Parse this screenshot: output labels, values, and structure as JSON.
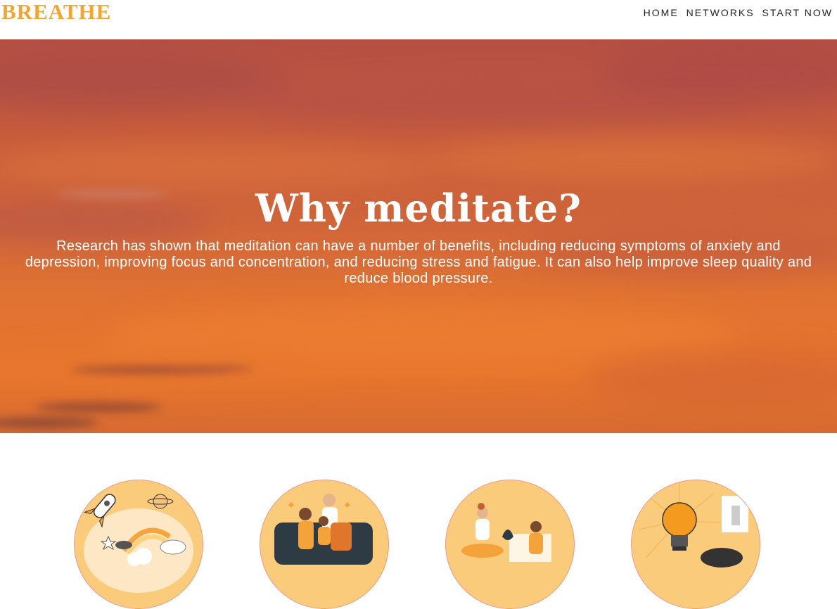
{
  "header": {
    "logo": "BREATHE",
    "nav": [
      {
        "label": "HOME"
      },
      {
        "label": "NETWORKS"
      },
      {
        "label": "START NOW"
      }
    ]
  },
  "hero": {
    "title": "Why meditate?",
    "text": "Research has shown that meditation can have a number of benefits, including reducing symptoms of anxiety and depression, improving focus and concentration, and reducing stress and fatigue. It can also help improve sleep quality and reduce blood pressure."
  },
  "features": [
    {
      "illustration": "rocket-rainbow-unicorn-illustration"
    },
    {
      "illustration": "family-on-couch-illustration"
    },
    {
      "illustration": "people-meditating-illustration"
    },
    {
      "illustration": "lightbulb-idea-illustration"
    }
  ],
  "colors": {
    "brand": "#f2a531",
    "hero_sky": "#d9662f",
    "card_circle": "#fbcb7c",
    "card_border": "#e69a8a"
  }
}
